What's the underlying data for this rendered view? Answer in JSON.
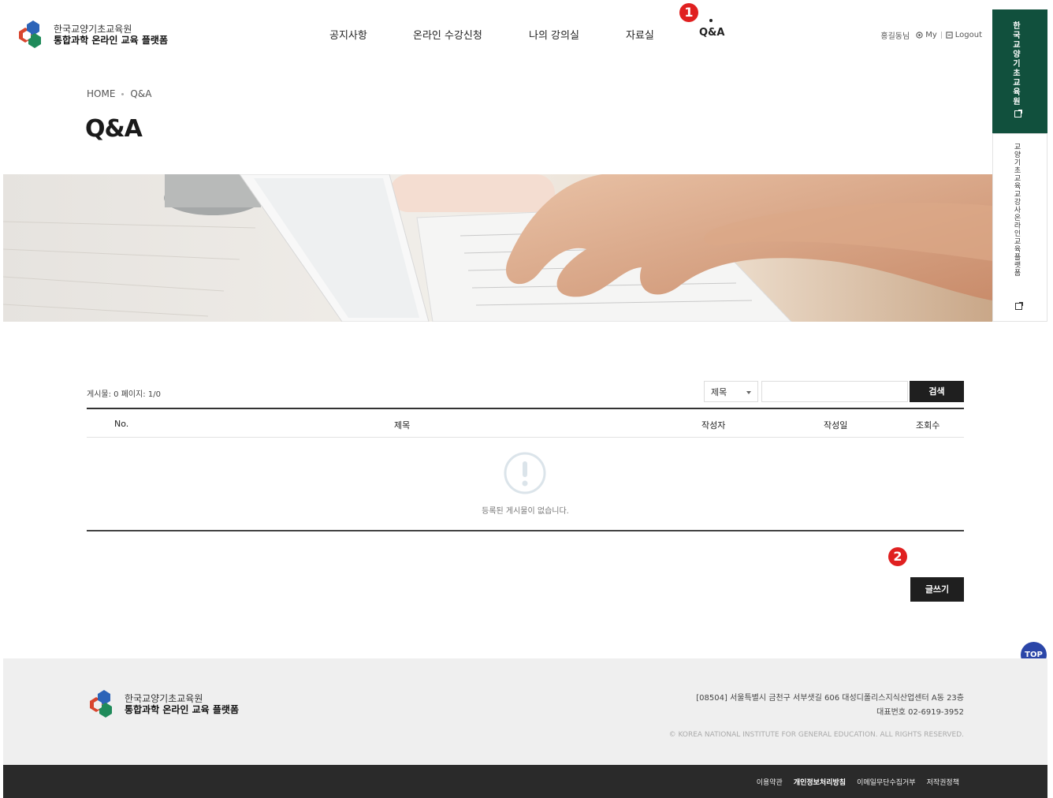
{
  "brand": {
    "name_line1": "한국교양기초교육원",
    "name_line2": "통합과학 온라인 교육 플랫폼"
  },
  "nav": {
    "items": [
      {
        "label": "공지사항"
      },
      {
        "label": "온라인 수강신청"
      },
      {
        "label": "나의 강의실"
      },
      {
        "label": "자료실"
      },
      {
        "label": "Q&A",
        "active": true
      }
    ]
  },
  "util": {
    "user": "홍길동님",
    "my": "My",
    "logout": "Logout"
  },
  "callouts": {
    "one": "1",
    "two": "2"
  },
  "side": {
    "link1": "한국교양기초교육원",
    "link2": "교양기초교육교강사온라인교육플랫폼"
  },
  "breadcrumb": {
    "home": "HOME",
    "current": "Q&A"
  },
  "page_title": "Q&A",
  "board": {
    "info": "게시물: 0  페이지: 1/0",
    "search_select": "제목",
    "search_button": "검색",
    "columns": {
      "no": "No.",
      "title": "제목",
      "author": "작성자",
      "date": "작성일",
      "views": "조회수"
    },
    "empty_message": "등록된 게시물이 없습니다.",
    "write_button": "글쓰기"
  },
  "top_button": "TOP",
  "footer": {
    "name_line1": "한국교양기초교육원",
    "name_line2": "통합과학 온라인 교육 플랫폼",
    "address": "[08504] 서울특별시 금천구 서부샛길 606 대성디폴리스지식산업센터 A동 23층",
    "phone": "대표번호 02-6919-3952",
    "copyright": "© KOREA NATIONAL INSTITUTE FOR GENERAL EDUCATION. ALL RIGHTS RESERVED.",
    "links": [
      {
        "label": "이용약관"
      },
      {
        "label": "개인정보처리방침",
        "strong": true
      },
      {
        "label": "이메일무단수집거부"
      },
      {
        "label": "저작권정책"
      }
    ]
  },
  "colors": {
    "brand_green": "#11503d",
    "callout_red": "#e02020",
    "top_blue": "#2b46a8",
    "button_dark": "#1f1f1f"
  }
}
